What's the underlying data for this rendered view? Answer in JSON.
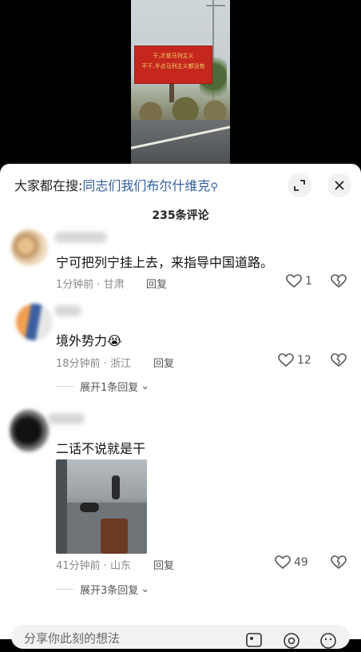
{
  "video": {
    "billboard_line1": "干,才是马列主义",
    "billboard_line2": "不干,半点马列主义都没有"
  },
  "header": {
    "search_prefix": "大家都在搜:",
    "search_link": "同志们我们布尔什维克",
    "comment_count": "235条评论"
  },
  "comments": [
    {
      "text": "宁可把列宁挂上去，来指导中国道路。",
      "meta": "1分钟前 · 甘肃",
      "reply_label": "回复",
      "likes": "1"
    },
    {
      "text": "境外势力😭",
      "meta": "18分钟前 · 浙江",
      "reply_label": "回复",
      "likes": "12",
      "expand_label": "展开1条回复"
    },
    {
      "text": "二话不说就是干",
      "meta": "41分钟前 · 山东",
      "reply_label": "回复",
      "likes": "49",
      "expand_label": "展开3条回复"
    }
  ],
  "input": {
    "placeholder": "分享你此刻的想法"
  },
  "icons": {
    "expand": "expand-icon",
    "close": "close-icon",
    "like": "heart-icon",
    "dislike": "broken-heart-icon",
    "image": "image-icon",
    "at": "at-icon",
    "emoji": "emoji-icon"
  }
}
